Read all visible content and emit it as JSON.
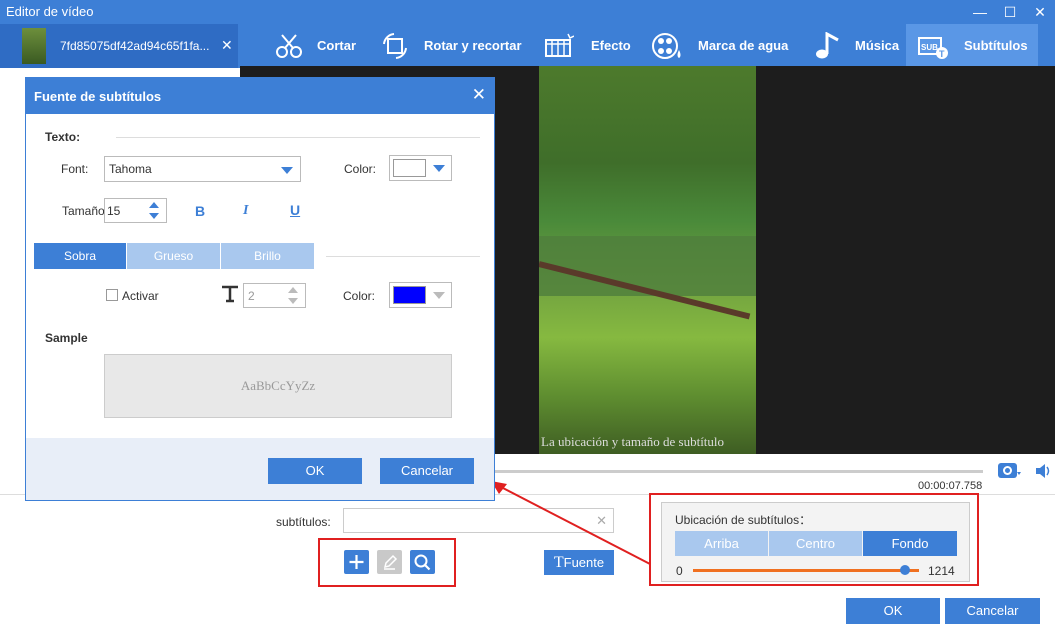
{
  "window": {
    "title": "Editor de vídeo",
    "min": "—",
    "max": "☐",
    "close": "✕"
  },
  "file_tab": {
    "name": "7fd85075df42ad94c65f1fa...",
    "close": "✕"
  },
  "tools": [
    {
      "label": "Cortar",
      "icon": "scissors-icon"
    },
    {
      "label": "Rotar y recortar",
      "icon": "rotate-crop-icon"
    },
    {
      "label": "Efecto",
      "icon": "effect-icon"
    },
    {
      "label": "Marca de agua",
      "icon": "watermark-icon"
    },
    {
      "label": "Música",
      "icon": "music-icon"
    },
    {
      "label": "Subtítulos",
      "icon": "subtitle-icon"
    }
  ],
  "video": {
    "caption": "La ubicación y tamaño de subtítulo"
  },
  "player": {
    "timecode": "00:00:07.758"
  },
  "subtitles": {
    "label": "subtítulos:",
    "value": "",
    "clear": "✕",
    "fuente_button": "Fuente"
  },
  "location": {
    "title": "Ubicación de subtítulos：",
    "options": [
      "Arriba",
      "Centro",
      "Fondo"
    ],
    "selected": "Fondo",
    "min": "0",
    "max": "1214",
    "value": 1214
  },
  "footer": {
    "ok": "OK",
    "cancel": "Cancelar"
  },
  "dialog": {
    "title": "Fuente de subtítulos",
    "close": "✕",
    "text_section": "Texto:",
    "font_label": "Font:",
    "font_value": "Tahoma",
    "color_label": "Color:",
    "text_color": "#ffffff",
    "size_label": "Tamaño",
    "size_value": "15",
    "bold": "B",
    "italic": "I",
    "underline": "U",
    "tabs": [
      "Sobra",
      "Grueso",
      "Brillo"
    ],
    "active_tab": "Sobra",
    "activate_label": "Activar",
    "shadow_size": "2",
    "shadow_color_label": "Color:",
    "shadow_color": "#0000ff",
    "sample_label": "Sample",
    "sample_text": "AaBbCcYyZz",
    "ok": "OK",
    "cancel": "Cancelar"
  },
  "colors": {
    "accent": "#3d7fd6",
    "highlight": "#e02020",
    "slider": "#f07020"
  }
}
